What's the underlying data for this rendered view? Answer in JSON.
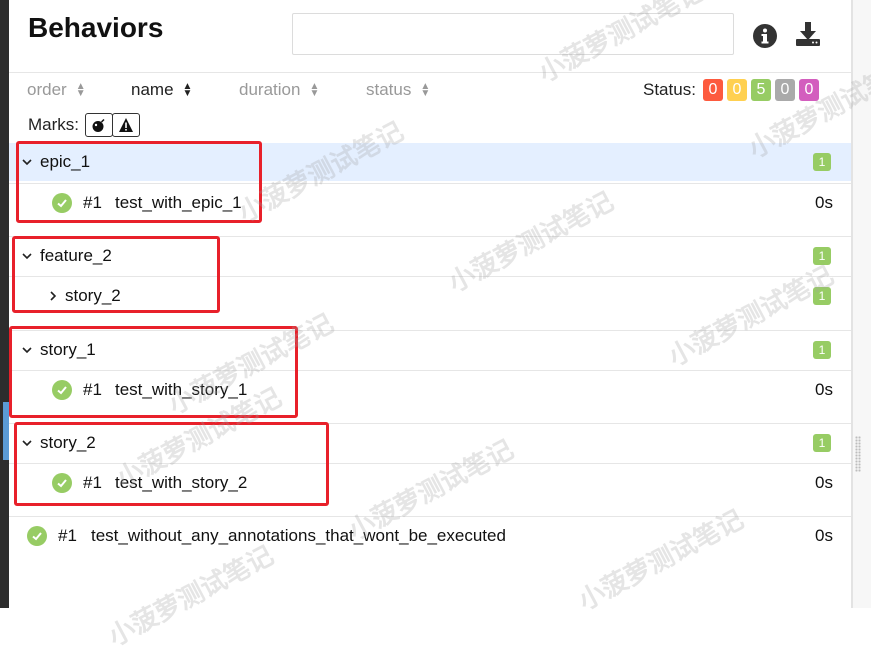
{
  "page": {
    "title": "Behaviors"
  },
  "search": {
    "value": "",
    "placeholder": ""
  },
  "sort": {
    "order": "order",
    "name": "name",
    "duration": "duration",
    "status": "status",
    "active": "name"
  },
  "status_filter": {
    "label": "Status:",
    "counts": [
      {
        "value": "0",
        "color": "#fd5a3e",
        "meaning": "failed"
      },
      {
        "value": "0",
        "color": "#ffd050",
        "meaning": "broken"
      },
      {
        "value": "5",
        "color": "#97cc64",
        "meaning": "passed"
      },
      {
        "value": "0",
        "color": "#aaaaaa",
        "meaning": "skipped"
      },
      {
        "value": "0",
        "color": "#d35ebe",
        "meaning": "unknown"
      }
    ]
  },
  "marks": {
    "label": "Marks:",
    "icons": [
      "bomb-icon",
      "warning-icon"
    ]
  },
  "tree": {
    "epic_1": {
      "label": "epic_1",
      "count": "1"
    },
    "epic_1_test": {
      "num": "#1",
      "name": "test_with_epic_1",
      "duration": "0s"
    },
    "feature_2": {
      "label": "feature_2",
      "count": "1"
    },
    "story_2_nested": {
      "label": "story_2",
      "count": "1"
    },
    "story_1": {
      "label": "story_1",
      "count": "1"
    },
    "story_1_test": {
      "num": "#1",
      "name": "test_with_story_1",
      "duration": "0s"
    },
    "story_2": {
      "label": "story_2",
      "count": "1"
    },
    "story_2_test": {
      "num": "#1",
      "name": "test_with_story_2",
      "duration": "0s"
    },
    "root_test": {
      "num": "#1",
      "name": "test_without_any_annotations_that_wont_be_executed",
      "duration": "0s"
    }
  },
  "watermark": {
    "text": "小菠萝测试笔记"
  },
  "colors": {
    "selected_row": "#e4efff",
    "passed": "#97cc64",
    "highlight_box": "#e8202a"
  }
}
